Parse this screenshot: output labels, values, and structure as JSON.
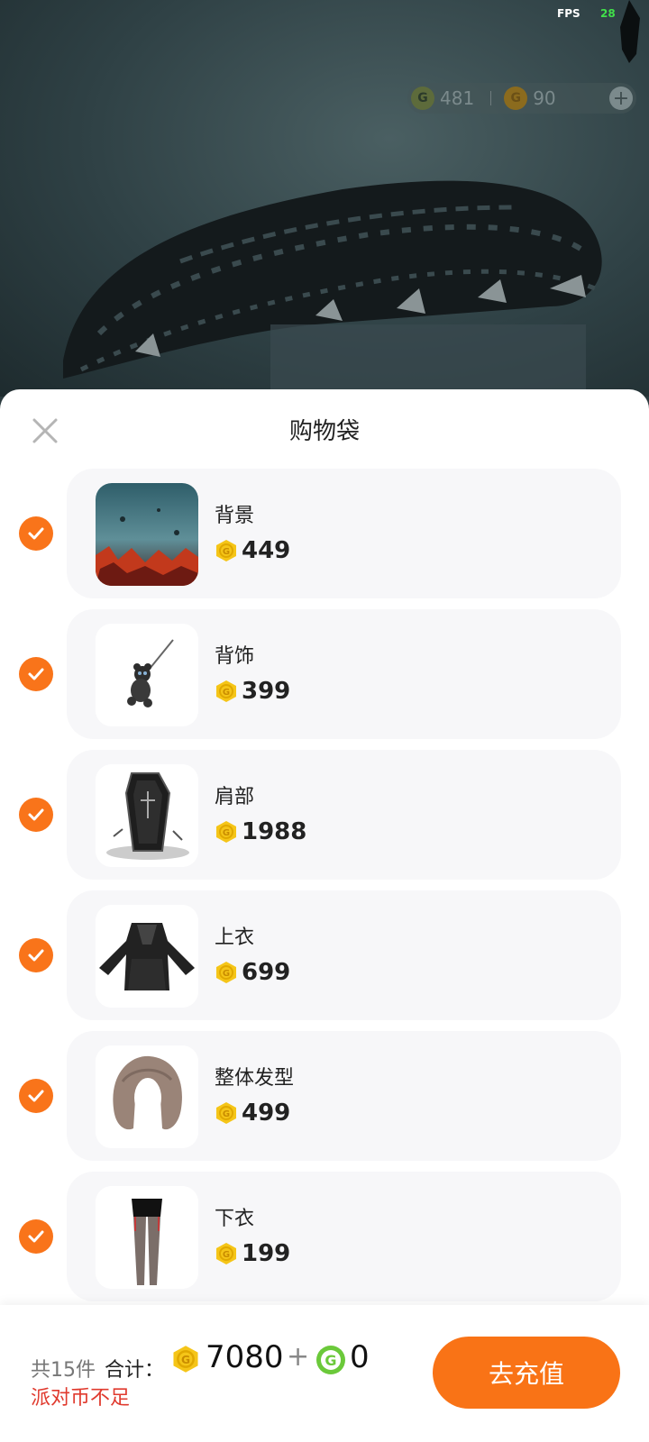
{
  "hud": {
    "fps_label": "FPS",
    "fps_value": "28",
    "green_currency": "481",
    "gold_currency": "90"
  },
  "sheet": {
    "title": "购物袋"
  },
  "items": [
    {
      "name": "背景",
      "price": "449"
    },
    {
      "name": "背饰",
      "price": "399"
    },
    {
      "name": "肩部",
      "price": "1988"
    },
    {
      "name": "上衣",
      "price": "699"
    },
    {
      "name": "整体发型",
      "price": "499"
    },
    {
      "name": "下衣",
      "price": "199"
    }
  ],
  "footer": {
    "count": "共15件",
    "total_label": "合计：",
    "gold_total": "7080",
    "plus": "+",
    "green_total": "0",
    "warning": "派对币不足",
    "recharge_label": "去充值"
  },
  "colors": {
    "accent": "#f97316",
    "coin": "#f5c518",
    "green_coin": "#6bc93a",
    "warning": "#e03a2e"
  }
}
